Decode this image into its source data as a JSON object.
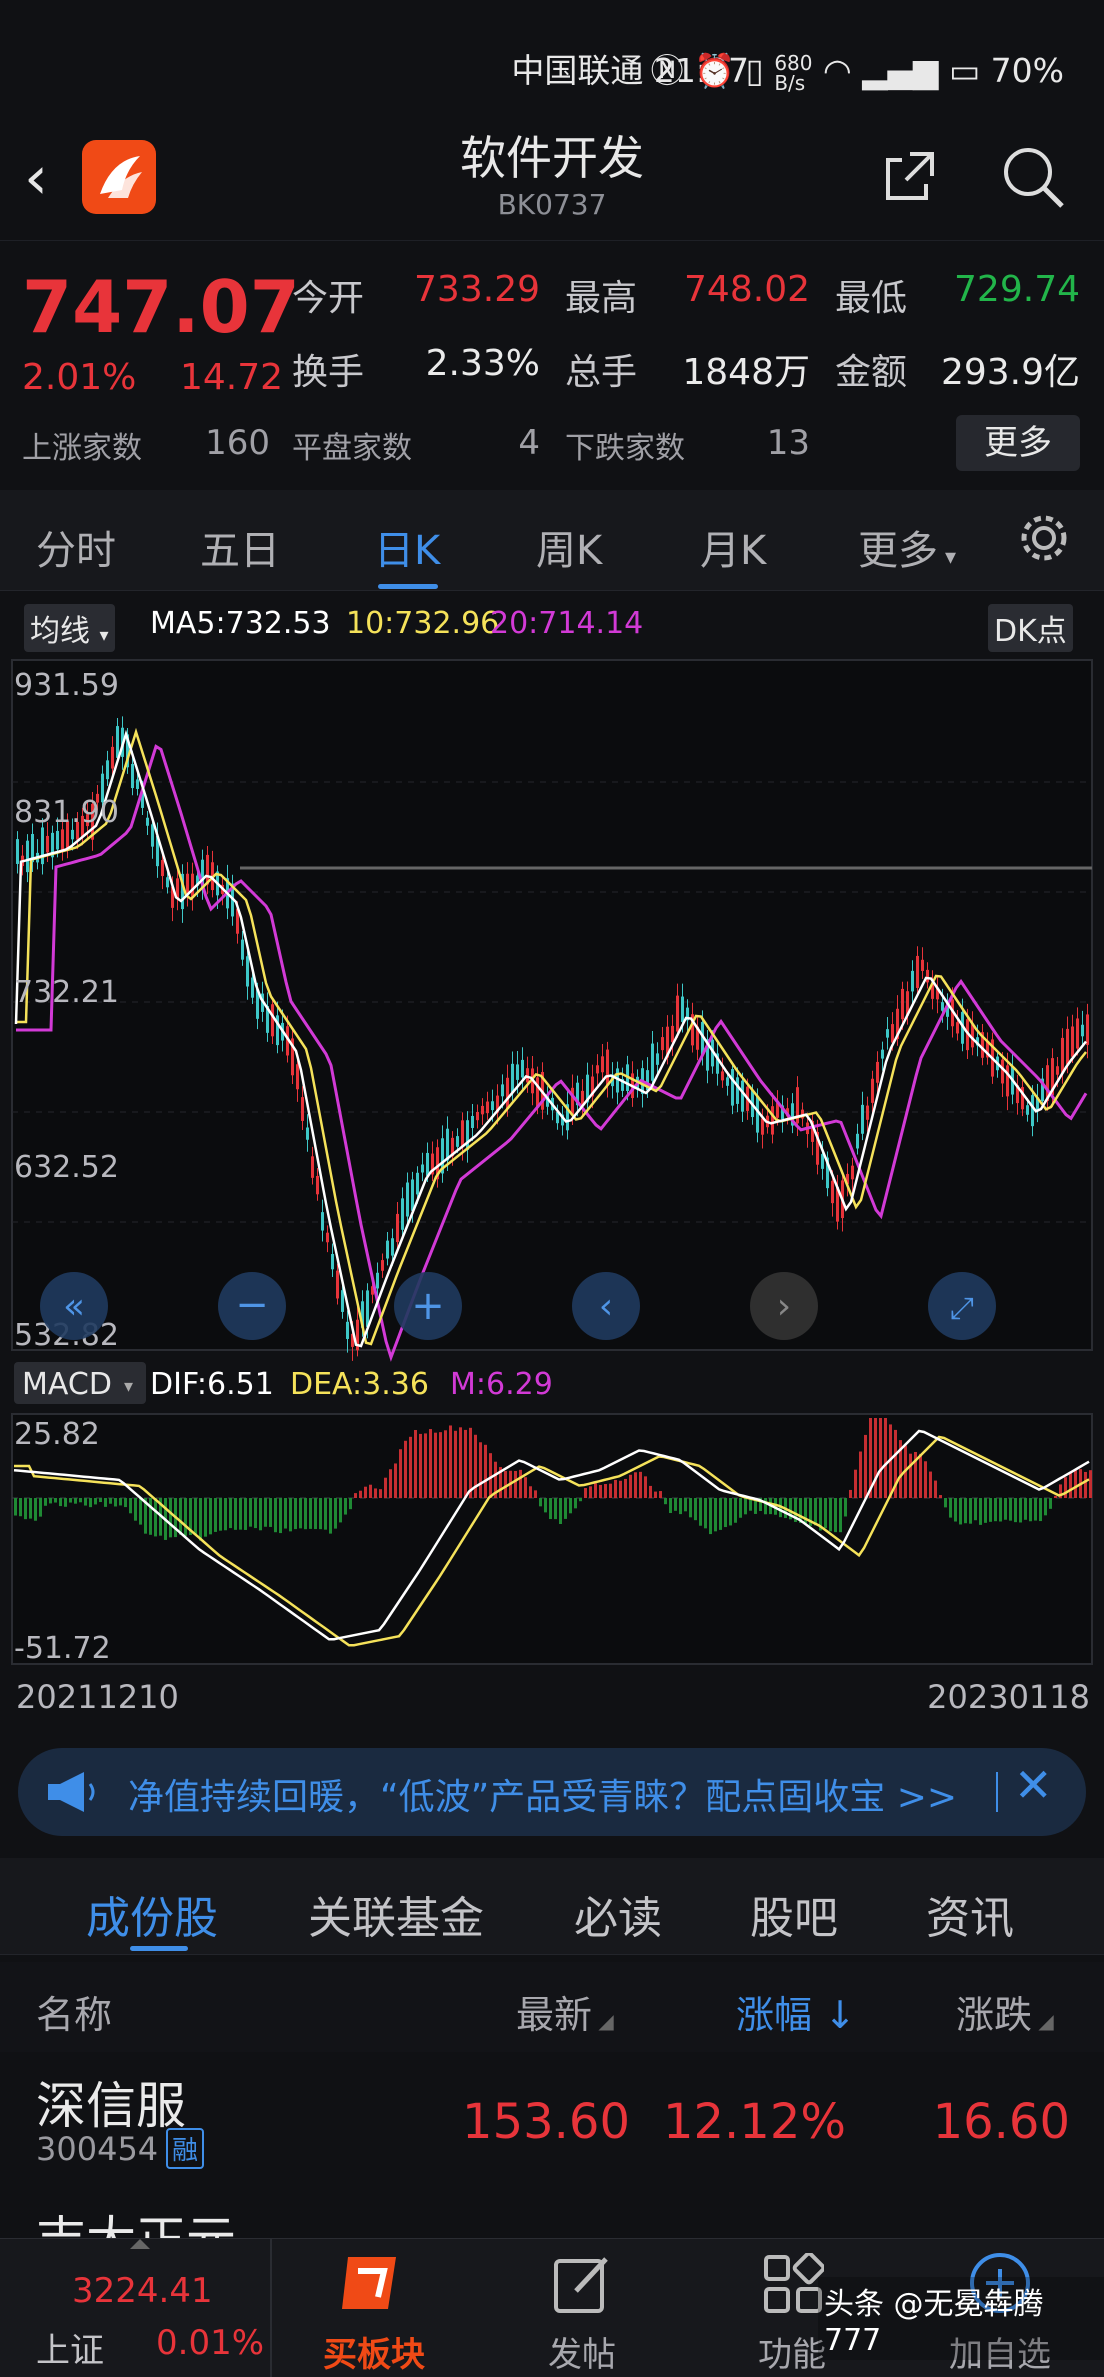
{
  "status": {
    "carrier_time": "中国联通 21:37",
    "speed": "680\nB/s",
    "battery": "70%"
  },
  "header": {
    "title": "软件开发",
    "code": "BK0737"
  },
  "quote": {
    "price": "747.07",
    "pct": "2.01%",
    "change": "14.72",
    "open_label": "今开",
    "open": "733.29",
    "high_label": "最高",
    "high": "748.02",
    "low_label": "最低",
    "low": "729.74",
    "turnover_label": "换手",
    "turnover": "2.33%",
    "volume_label": "总手",
    "volume": "1848万",
    "amount_label": "金额",
    "amount": "293.9亿",
    "up_label": "上涨家数",
    "up": "160",
    "flat_label": "平盘家数",
    "flat": "4",
    "down_label": "下跌家数",
    "down": "13",
    "more": "更多"
  },
  "ktabs": [
    "分时",
    "五日",
    "日K",
    "周K",
    "月K",
    "更多"
  ],
  "ma": {
    "selector": "均线",
    "ma5": "MA5:732.53",
    "ma10": "10:732.96",
    "ma20": "20:714.14",
    "dk": "DK点"
  },
  "y_labels": [
    "931.59",
    "831.90",
    "732.21",
    "632.52",
    "532.82"
  ],
  "macd": {
    "selector": "MACD",
    "dif": "DIF:6.51",
    "dea": "DEA:3.36",
    "m": "M:6.29",
    "top": "25.82",
    "bottom": "-51.72"
  },
  "dates": {
    "start": "20211210",
    "end": "20230118"
  },
  "ad": {
    "text": "净值持续回暖，“低波”产品受青睐？配点固收宝 >>"
  },
  "stabs": [
    "成份股",
    "关联基金",
    "必读",
    "股吧",
    "资讯"
  ],
  "table": {
    "headers": {
      "name": "名称",
      "latest": "最新",
      "pct": "涨幅",
      "change": "涨跌"
    },
    "row": {
      "name": "深信服",
      "code": "300454",
      "tag": "融",
      "latest": "153.60",
      "pct": "12.12%",
      "change": "16.60"
    },
    "next_name": "吉大正元"
  },
  "bottomnav": {
    "index_value": "3224.41",
    "index_name": "上证",
    "index_pct": "0.01%",
    "buy": "买板块",
    "post": "发帖",
    "func": "功能",
    "add": "加自选",
    "watermark": "头条 @无冕犇腾777"
  },
  "colors": {
    "up": "#e8343a",
    "down": "#22b54a",
    "accent": "#3f8ee8",
    "ma5": "#ffffff",
    "ma10": "#f5e25a",
    "ma20": "#d23ad6"
  }
}
